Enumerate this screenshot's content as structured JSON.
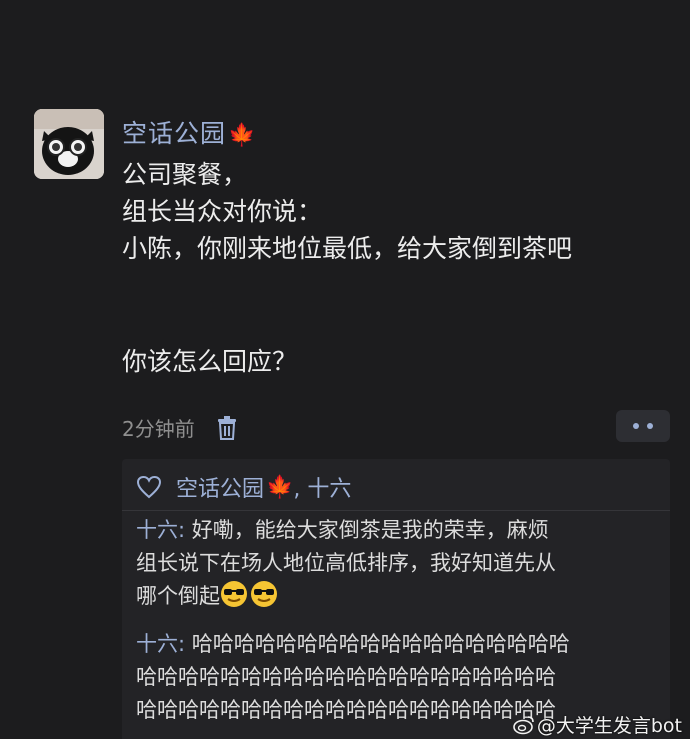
{
  "post": {
    "author": "空话公园",
    "lines": [
      "公司聚餐，",
      "组长当众对你说：",
      "小陈，你刚来地位最低，给大家倒到茶吧"
    ],
    "question": "你该怎么回应？",
    "timestamp": "2分钟前"
  },
  "likes": {
    "names": "空话公园",
    "more": ", 十六"
  },
  "comments": [
    {
      "user": "十六:",
      "line1": " 好嘞，能给大家倒茶是我的荣幸，麻烦",
      "line2": "组长说下在场人地位高低排序，我好知道先从",
      "line3": "哪个倒起"
    },
    {
      "user": "十六:",
      "line1": " 哈哈哈哈哈哈哈哈哈哈哈哈哈哈哈哈哈哈",
      "line2": "哈哈哈哈哈哈哈哈哈哈哈哈哈哈哈哈哈哈哈哈",
      "line3": "哈哈哈哈哈哈哈哈哈哈哈哈哈哈哈哈哈哈哈哈"
    }
  ],
  "watermark": "@大学生发言bot",
  "colors": {
    "background": "#1c1c1e",
    "link": "#9db0d6",
    "leaf": "#e0502c"
  }
}
